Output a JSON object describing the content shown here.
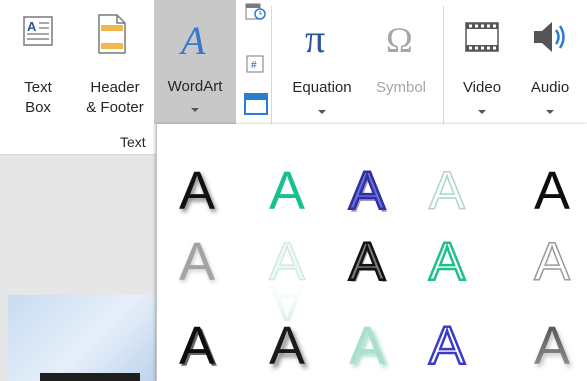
{
  "ribbon": {
    "text_box": {
      "label_1": "Text",
      "label_2": "Box"
    },
    "header_footer": {
      "label_1": "Header",
      "label_2": "& Footer"
    },
    "wordart": {
      "label": "WordArt"
    },
    "equation": {
      "label": "Equation"
    },
    "symbol": {
      "label": "Symbol"
    },
    "video": {
      "label": "Video"
    },
    "audio": {
      "label": "Audio"
    },
    "text_group_label": "Text"
  },
  "gallery": {
    "glyph": "A",
    "styles": [
      "Fill: Black, Text color 1; Shadow",
      "Fill: Teal, Accent color",
      "Fill: Blue, Accent color; Outline",
      "Fill: White; Outline: Teal",
      "Fill: Black, Text color 1",
      "Fill: Gray; Shadow",
      "Fill: White; Reflection",
      "Fill: Gray; Outline: Black",
      "Fill: White; Outline: Teal",
      "Fill: White; Outline: Gray",
      "Fill: Black; Shadow",
      "Fill: Black; Soft shadow",
      "Fill: Light teal; Shadow",
      "Fill: White; Outline: Blue",
      "Fill: Gray; Shadow"
    ]
  }
}
